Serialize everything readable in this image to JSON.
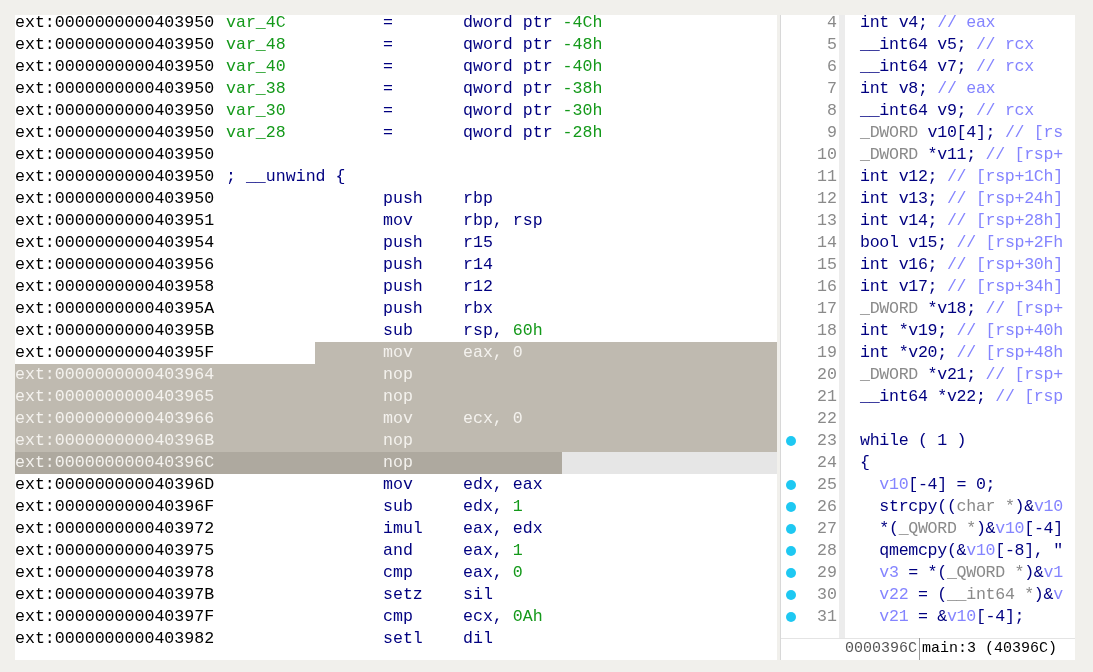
{
  "disassembly": {
    "rows": [
      {
        "address": "ext:0000000000403950",
        "name": "var_4C",
        "mnemonic": "=",
        "operands": [
          {
            "kind": "reg",
            "text": "dword ptr "
          },
          {
            "kind": "num",
            "text": "-4Ch"
          }
        ],
        "selected": false,
        "cursor": false
      },
      {
        "address": "ext:0000000000403950",
        "name": "var_48",
        "mnemonic": "=",
        "operands": [
          {
            "kind": "reg",
            "text": "qword ptr "
          },
          {
            "kind": "num",
            "text": "-48h"
          }
        ],
        "selected": false,
        "cursor": false
      },
      {
        "address": "ext:0000000000403950",
        "name": "var_40",
        "mnemonic": "=",
        "operands": [
          {
            "kind": "reg",
            "text": "qword ptr "
          },
          {
            "kind": "num",
            "text": "-40h"
          }
        ],
        "selected": false,
        "cursor": false
      },
      {
        "address": "ext:0000000000403950",
        "name": "var_38",
        "mnemonic": "=",
        "operands": [
          {
            "kind": "reg",
            "text": "qword ptr "
          },
          {
            "kind": "num",
            "text": "-38h"
          }
        ],
        "selected": false,
        "cursor": false
      },
      {
        "address": "ext:0000000000403950",
        "name": "var_30",
        "mnemonic": "=",
        "operands": [
          {
            "kind": "reg",
            "text": "qword ptr "
          },
          {
            "kind": "num",
            "text": "-30h"
          }
        ],
        "selected": false,
        "cursor": false
      },
      {
        "address": "ext:0000000000403950",
        "name": "var_28",
        "mnemonic": "=",
        "operands": [
          {
            "kind": "reg",
            "text": "qword ptr "
          },
          {
            "kind": "num",
            "text": "-28h"
          }
        ],
        "selected": false,
        "cursor": false
      },
      {
        "address": "ext:0000000000403950",
        "selected": false,
        "cursor": false
      },
      {
        "address": "ext:0000000000403950",
        "comment": "; __unwind {",
        "selected": false,
        "cursor": false
      },
      {
        "address": "ext:0000000000403950",
        "mnemonic": "push",
        "operands": [
          {
            "kind": "reg",
            "text": "rbp"
          }
        ],
        "selected": false,
        "cursor": false
      },
      {
        "address": "ext:0000000000403951",
        "mnemonic": "mov",
        "operands": [
          {
            "kind": "reg",
            "text": "rbp, rsp"
          }
        ],
        "selected": false,
        "cursor": false
      },
      {
        "address": "ext:0000000000403954",
        "mnemonic": "push",
        "operands": [
          {
            "kind": "reg",
            "text": "r15"
          }
        ],
        "selected": false,
        "cursor": false
      },
      {
        "address": "ext:0000000000403956",
        "mnemonic": "push",
        "operands": [
          {
            "kind": "reg",
            "text": "r14"
          }
        ],
        "selected": false,
        "cursor": false
      },
      {
        "address": "ext:0000000000403958",
        "mnemonic": "push",
        "operands": [
          {
            "kind": "reg",
            "text": "r12"
          }
        ],
        "selected": false,
        "cursor": false
      },
      {
        "address": "ext:000000000040395A",
        "mnemonic": "push",
        "operands": [
          {
            "kind": "reg",
            "text": "rbx"
          }
        ],
        "selected": false,
        "cursor": false
      },
      {
        "address": "ext:000000000040395B",
        "mnemonic": "sub",
        "operands": [
          {
            "kind": "reg",
            "text": "rsp, "
          },
          {
            "kind": "num",
            "text": "60h"
          }
        ],
        "selected": false,
        "cursor": false
      },
      {
        "address": "ext:000000000040395F",
        "mnemonic": "mov",
        "operands": [
          {
            "kind": "reg",
            "text": "eax, "
          },
          {
            "kind": "num",
            "text": "0"
          }
        ],
        "selected": true,
        "cursor": false
      },
      {
        "address": "ext:0000000000403964",
        "mnemonic": "nop",
        "selected": true,
        "cursor": false
      },
      {
        "address": "ext:0000000000403965",
        "mnemonic": "nop",
        "selected": true,
        "cursor": false
      },
      {
        "address": "ext:0000000000403966",
        "mnemonic": "mov",
        "operands": [
          {
            "kind": "reg",
            "text": "ecx, "
          },
          {
            "kind": "num",
            "text": "0"
          }
        ],
        "selected": true,
        "cursor": false
      },
      {
        "address": "ext:000000000040396B",
        "mnemonic": "nop",
        "selected": true,
        "cursor": false
      },
      {
        "address": "ext:000000000040396C",
        "mnemonic": "nop",
        "selected": true,
        "cursor": true
      },
      {
        "address": "ext:000000000040396D",
        "mnemonic": "mov",
        "operands": [
          {
            "kind": "reg",
            "text": "edx, eax"
          }
        ],
        "selected": false,
        "cursor": false
      },
      {
        "address": "ext:000000000040396F",
        "mnemonic": "sub",
        "operands": [
          {
            "kind": "reg",
            "text": "edx, "
          },
          {
            "kind": "num",
            "text": "1"
          }
        ],
        "selected": false,
        "cursor": false
      },
      {
        "address": "ext:0000000000403972",
        "mnemonic": "imul",
        "operands": [
          {
            "kind": "reg",
            "text": "eax, edx"
          }
        ],
        "selected": false,
        "cursor": false
      },
      {
        "address": "ext:0000000000403975",
        "mnemonic": "and",
        "operands": [
          {
            "kind": "reg",
            "text": "eax, "
          },
          {
            "kind": "num",
            "text": "1"
          }
        ],
        "selected": false,
        "cursor": false
      },
      {
        "address": "ext:0000000000403978",
        "mnemonic": "cmp",
        "operands": [
          {
            "kind": "reg",
            "text": "eax, "
          },
          {
            "kind": "num",
            "text": "0"
          }
        ],
        "selected": false,
        "cursor": false
      },
      {
        "address": "ext:000000000040397B",
        "mnemonic": "setz",
        "operands": [
          {
            "kind": "reg",
            "text": "sil"
          }
        ],
        "selected": false,
        "cursor": false
      },
      {
        "address": "ext:000000000040397F",
        "mnemonic": "cmp",
        "operands": [
          {
            "kind": "reg",
            "text": "ecx, "
          },
          {
            "kind": "num",
            "text": "0Ah"
          }
        ],
        "selected": false,
        "cursor": false
      },
      {
        "address": "ext:0000000000403982",
        "mnemonic": "setl",
        "operands": [
          {
            "kind": "reg",
            "text": "dil"
          }
        ],
        "selected": false,
        "cursor": false
      }
    ]
  },
  "pseudocode": {
    "lines": [
      {
        "number": "4",
        "marked": false,
        "tokens": [
          {
            "kind": "kw",
            "text": "int v4; "
          },
          {
            "kind": "comment",
            "text": "// eax"
          }
        ]
      },
      {
        "number": "5",
        "marked": false,
        "tokens": [
          {
            "kind": "kw",
            "text": "__int64 v5; "
          },
          {
            "kind": "comment",
            "text": "// rcx"
          }
        ]
      },
      {
        "number": "6",
        "marked": false,
        "tokens": [
          {
            "kind": "kw",
            "text": "__int64 v7; "
          },
          {
            "kind": "comment",
            "text": "// rcx"
          }
        ]
      },
      {
        "number": "7",
        "marked": false,
        "tokens": [
          {
            "kind": "kw",
            "text": "int v8; "
          },
          {
            "kind": "comment",
            "text": "// eax"
          }
        ]
      },
      {
        "number": "8",
        "marked": false,
        "tokens": [
          {
            "kind": "kw",
            "text": "__int64 v9; "
          },
          {
            "kind": "comment",
            "text": "// rcx"
          }
        ]
      },
      {
        "number": "9",
        "marked": false,
        "tokens": [
          {
            "kind": "type",
            "text": "_DWORD "
          },
          {
            "kind": "kw",
            "text": "v10[4]; "
          },
          {
            "kind": "comment",
            "text": "// [rs"
          }
        ]
      },
      {
        "number": "10",
        "marked": false,
        "tokens": [
          {
            "kind": "type",
            "text": "_DWORD "
          },
          {
            "kind": "kw",
            "text": "*v11; "
          },
          {
            "kind": "comment",
            "text": "// [rsp+"
          }
        ]
      },
      {
        "number": "11",
        "marked": false,
        "tokens": [
          {
            "kind": "kw",
            "text": "int v12; "
          },
          {
            "kind": "comment",
            "text": "// [rsp+1Ch]"
          }
        ]
      },
      {
        "number": "12",
        "marked": false,
        "tokens": [
          {
            "kind": "kw",
            "text": "int v13; "
          },
          {
            "kind": "comment",
            "text": "// [rsp+24h]"
          }
        ]
      },
      {
        "number": "13",
        "marked": false,
        "tokens": [
          {
            "kind": "kw",
            "text": "int v14; "
          },
          {
            "kind": "comment",
            "text": "// [rsp+28h]"
          }
        ]
      },
      {
        "number": "14",
        "marked": false,
        "tokens": [
          {
            "kind": "kw",
            "text": "bool v15; "
          },
          {
            "kind": "comment",
            "text": "// [rsp+2Fh"
          }
        ]
      },
      {
        "number": "15",
        "marked": false,
        "tokens": [
          {
            "kind": "kw",
            "text": "int v16; "
          },
          {
            "kind": "comment",
            "text": "// [rsp+30h]"
          }
        ]
      },
      {
        "number": "16",
        "marked": false,
        "tokens": [
          {
            "kind": "kw",
            "text": "int v17; "
          },
          {
            "kind": "comment",
            "text": "// [rsp+34h]"
          }
        ]
      },
      {
        "number": "17",
        "marked": false,
        "tokens": [
          {
            "kind": "type",
            "text": "_DWORD "
          },
          {
            "kind": "kw",
            "text": "*v18; "
          },
          {
            "kind": "comment",
            "text": "// [rsp+"
          }
        ]
      },
      {
        "number": "18",
        "marked": false,
        "tokens": [
          {
            "kind": "kw",
            "text": "int *v19; "
          },
          {
            "kind": "comment",
            "text": "// [rsp+40h"
          }
        ]
      },
      {
        "number": "19",
        "marked": false,
        "tokens": [
          {
            "kind": "kw",
            "text": "int *v20; "
          },
          {
            "kind": "comment",
            "text": "// [rsp+48h"
          }
        ]
      },
      {
        "number": "20",
        "marked": false,
        "tokens": [
          {
            "kind": "type",
            "text": "_DWORD "
          },
          {
            "kind": "kw",
            "text": "*v21; "
          },
          {
            "kind": "comment",
            "text": "// [rsp+"
          }
        ]
      },
      {
        "number": "21",
        "marked": false,
        "tokens": [
          {
            "kind": "kw",
            "text": "__int64 *v22; "
          },
          {
            "kind": "comment",
            "text": "// [rsp"
          }
        ]
      },
      {
        "number": "22",
        "marked": false
      },
      {
        "number": "23",
        "marked": true,
        "tokens": [
          {
            "kind": "kw",
            "text": "while ( 1 )"
          }
        ]
      },
      {
        "number": "24",
        "marked": false,
        "tokens": [
          {
            "kind": "kw",
            "text": "{"
          }
        ]
      },
      {
        "number": "25",
        "marked": true,
        "tokens": [
          {
            "kind": "var",
            "text": "  v10"
          },
          {
            "kind": "kw",
            "text": "[-4] = 0;"
          }
        ]
      },
      {
        "number": "26",
        "marked": true,
        "tokens": [
          {
            "kind": "kw",
            "text": "  strcpy(("
          },
          {
            "kind": "type",
            "text": "char *"
          },
          {
            "kind": "kw",
            "text": ")&"
          },
          {
            "kind": "var",
            "text": "v10"
          }
        ]
      },
      {
        "number": "27",
        "marked": true,
        "tokens": [
          {
            "kind": "kw",
            "text": "  *("
          },
          {
            "kind": "type",
            "text": "_QWORD *"
          },
          {
            "kind": "kw",
            "text": ")&"
          },
          {
            "kind": "var",
            "text": "v10"
          },
          {
            "kind": "kw",
            "text": "[-4]"
          }
        ]
      },
      {
        "number": "28",
        "marked": true,
        "tokens": [
          {
            "kind": "kw",
            "text": "  qmemcpy(&"
          },
          {
            "kind": "var",
            "text": "v10"
          },
          {
            "kind": "kw",
            "text": "[-8], \""
          }
        ]
      },
      {
        "number": "29",
        "marked": true,
        "tokens": [
          {
            "kind": "var",
            "text": "  v3"
          },
          {
            "kind": "kw",
            "text": " = *("
          },
          {
            "kind": "type",
            "text": "_QWORD *"
          },
          {
            "kind": "kw",
            "text": ")&"
          },
          {
            "kind": "var",
            "text": "v1"
          }
        ]
      },
      {
        "number": "30",
        "marked": true,
        "tokens": [
          {
            "kind": "var",
            "text": "  v22"
          },
          {
            "kind": "kw",
            "text": " = ("
          },
          {
            "kind": "type",
            "text": "__int64 *"
          },
          {
            "kind": "kw",
            "text": ")&"
          },
          {
            "kind": "var",
            "text": "v"
          }
        ]
      },
      {
        "number": "31",
        "marked": true,
        "tokens": [
          {
            "kind": "var",
            "text": "  v21"
          },
          {
            "kind": "kw",
            "text": " = &"
          },
          {
            "kind": "var",
            "text": "v10"
          },
          {
            "kind": "kw",
            "text": "[-4];"
          }
        ]
      }
    ],
    "status": {
      "offset": "0000396C",
      "location": "main:3 (40396C)"
    }
  }
}
